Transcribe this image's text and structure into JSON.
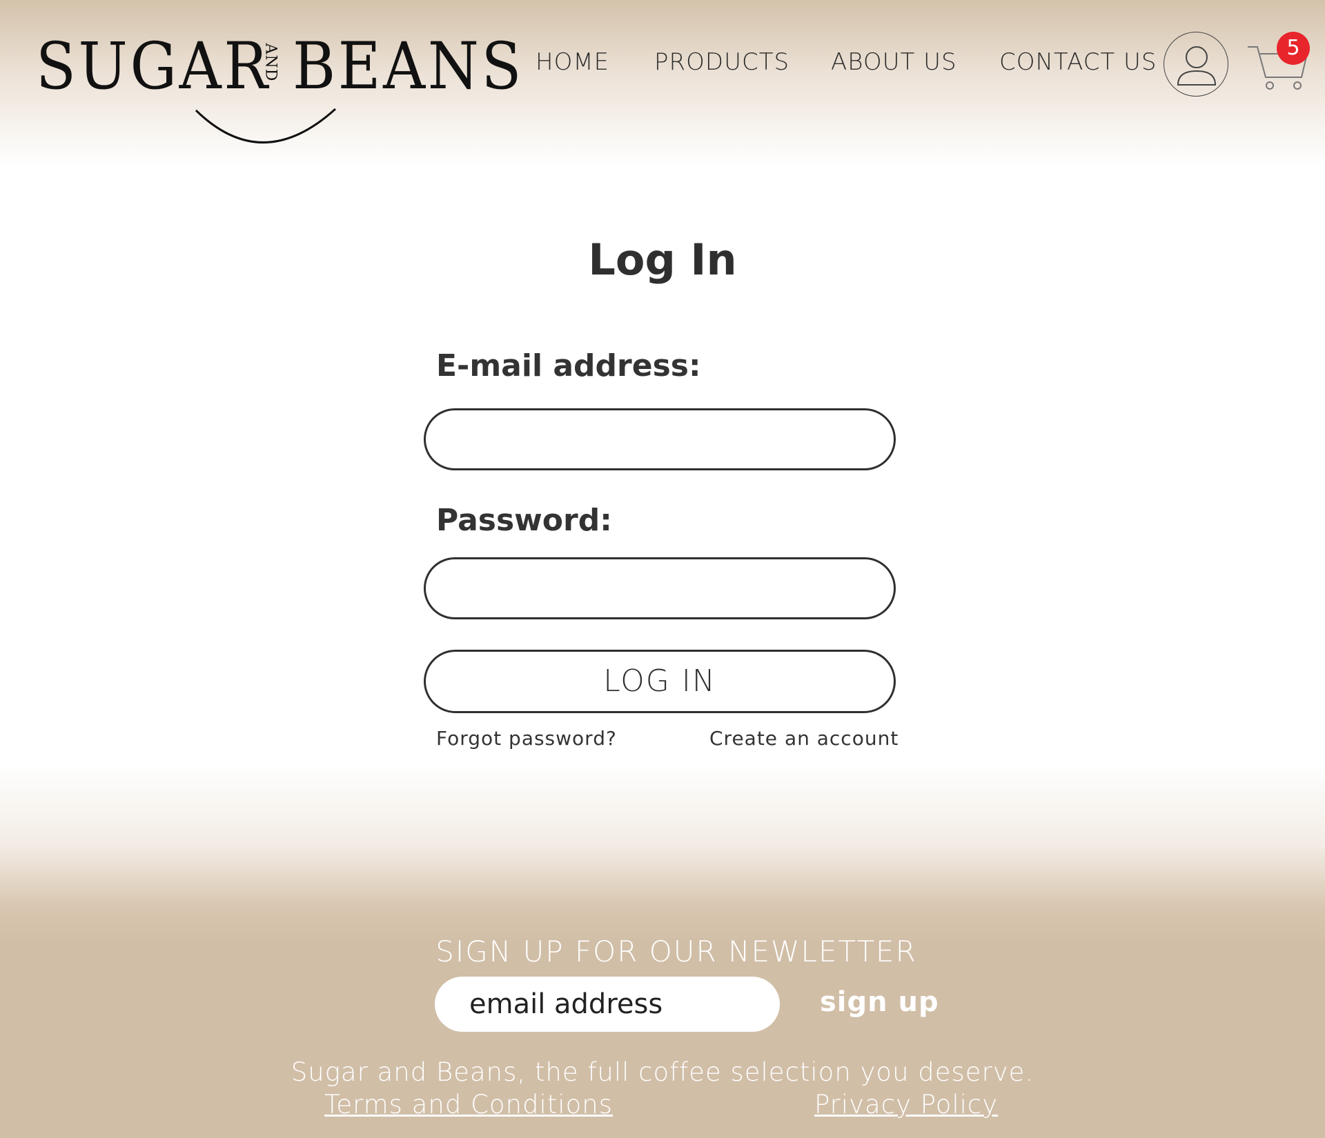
{
  "brand": {
    "word1": "SUGAR",
    "and": "AND",
    "word2": "BEANS"
  },
  "nav": {
    "home": "HOME",
    "products": "PRODUCTS",
    "about": "ABOUT US",
    "contact": "CONTACT US"
  },
  "cart": {
    "count": "5",
    "badge_color": "#e8252b"
  },
  "login": {
    "title": "Log In",
    "email_label": "E-mail address:",
    "email_value": "",
    "password_label": "Password:",
    "password_value": "",
    "button": "LOG IN",
    "forgot": "Forgot password?",
    "create": "Create an account"
  },
  "footer": {
    "newsletter_title": "SIGN UP FOR OUR NEWLETTER",
    "email_placeholder": "email address",
    "signup": "sign up",
    "tagline": "Sugar and Beans, the full coffee selection you deserve.",
    "terms": "Terms and Conditions",
    "privacy": "Privacy Policy"
  },
  "colors": {
    "accent": "#d1bea7",
    "text": "#2f2f2f"
  },
  "icons": {
    "account": "user-circle-icon",
    "cart": "shopping-cart-icon"
  }
}
